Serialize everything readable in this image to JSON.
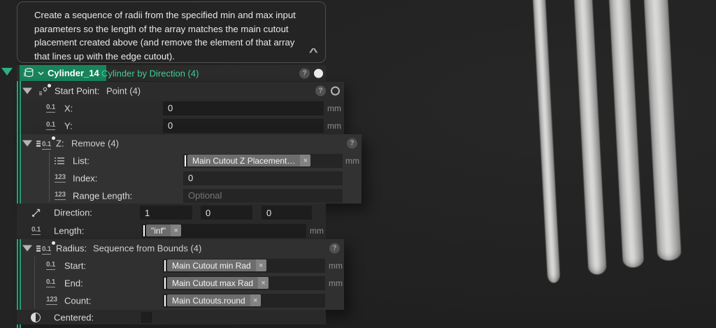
{
  "comment": {
    "text": "Create a sequence of radii from the specified min and max input parameters so the length of the array matches the main cutout placement created above (and remove the element of that array that lines up with the edge cutout).",
    "collapse_icon": "^"
  },
  "node": {
    "name": "Cylinder_14",
    "type": "Cylinder by Direction (4)"
  },
  "icons": {
    "decimal": "0.1",
    "integer": "123",
    "help": "?",
    "close": "×"
  },
  "units": {
    "mm": "mm"
  },
  "start_point": {
    "label": "Start Point:",
    "value": "Point (4)",
    "x": {
      "label": "X:",
      "value": "0",
      "unit": "mm"
    },
    "y": {
      "label": "Y:",
      "value": "0",
      "unit": "mm"
    }
  },
  "z": {
    "label": "Z:",
    "value": "Remove (4)",
    "list": {
      "label": "List:",
      "chip": "Main Cutout Z Placement…",
      "unit": "mm"
    },
    "index": {
      "label": "Index:",
      "value": "0"
    },
    "range_length": {
      "label": "Range Length:",
      "placeholder": "Optional"
    }
  },
  "direction": {
    "label": "Direction:",
    "x": "1",
    "y": "0",
    "z": "0"
  },
  "length": {
    "label": "Length:",
    "chip": "\"inf\"",
    "unit": "mm"
  },
  "radius": {
    "label": "Radius:",
    "value": "Sequence from Bounds (4)",
    "start": {
      "label": "Start:",
      "chip": "Main Cutout min Rad",
      "unit": "mm"
    },
    "end": {
      "label": "End:",
      "chip": "Main Cutout max Rad",
      "unit": "mm"
    },
    "count": {
      "label": "Count:",
      "chip": "Main Cutouts.round"
    }
  },
  "centered": {
    "label": "Centered:"
  },
  "viewport": {
    "cylinders": 4
  },
  "colors": {
    "selection_green": "#17845c",
    "accent_green": "#3ed094",
    "chip_gray": "#6d6d6d"
  }
}
